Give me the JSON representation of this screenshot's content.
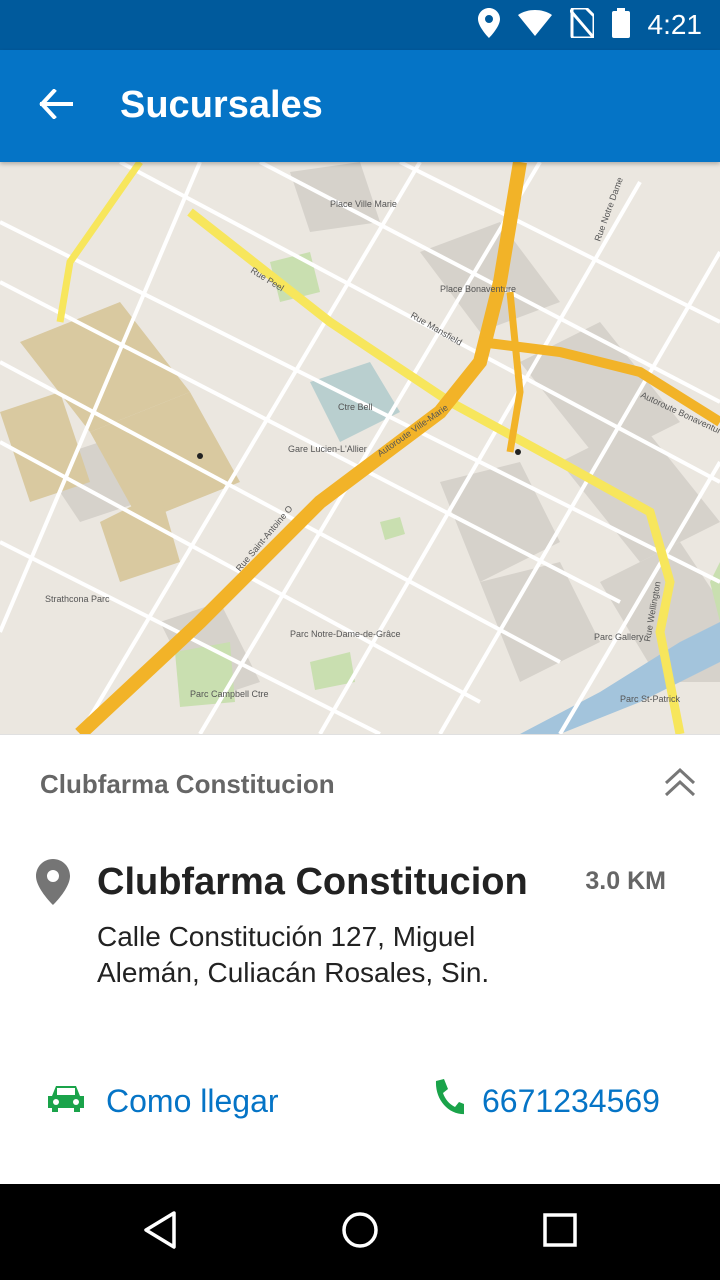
{
  "status_bar": {
    "time": "4:21",
    "icons": [
      "location-icon",
      "wifi-icon",
      "no-sim-icon",
      "battery-icon"
    ]
  },
  "app_bar": {
    "title": "Sucursales",
    "back_icon": "arrow-left-icon"
  },
  "map": {
    "labels": [
      "Rue Peel",
      "Autoroute Ville-Marie",
      "Place Bonaventure",
      "Ctre Bell",
      "Parc Gallery",
      "Parc St-Patrick",
      "Parc Notre-Dame-de-Grâce",
      "Strathcona Parc",
      "Place Ville Marie",
      "Rue Wellington",
      "Rue Notre Dame",
      "Rue Saint-Antoine O",
      "Autoroute Bonaventure",
      "Gare Lucien-L'Allier",
      "Parc Campbell Ctre",
      "Rue Mansfield"
    ]
  },
  "panel": {
    "header_title": "Clubfarma Constitucion",
    "collapse_icon": "double-chevron-up-icon"
  },
  "branch": {
    "name": "Clubfarma Constitucion",
    "distance": "3.0 KM",
    "address": "Calle Constitución 127, Miguel Alemán, Culiacán Rosales, Sin.",
    "directions_label": "Como llegar",
    "phone": "6671234569"
  },
  "colors": {
    "status_bar": "#005a9c",
    "app_bar": "#0574c6",
    "link": "#0574c6",
    "green_icon": "#1aa34a"
  },
  "nav_bar": {
    "icons": [
      "back-triangle-icon",
      "home-circle-icon",
      "recents-square-icon"
    ]
  }
}
